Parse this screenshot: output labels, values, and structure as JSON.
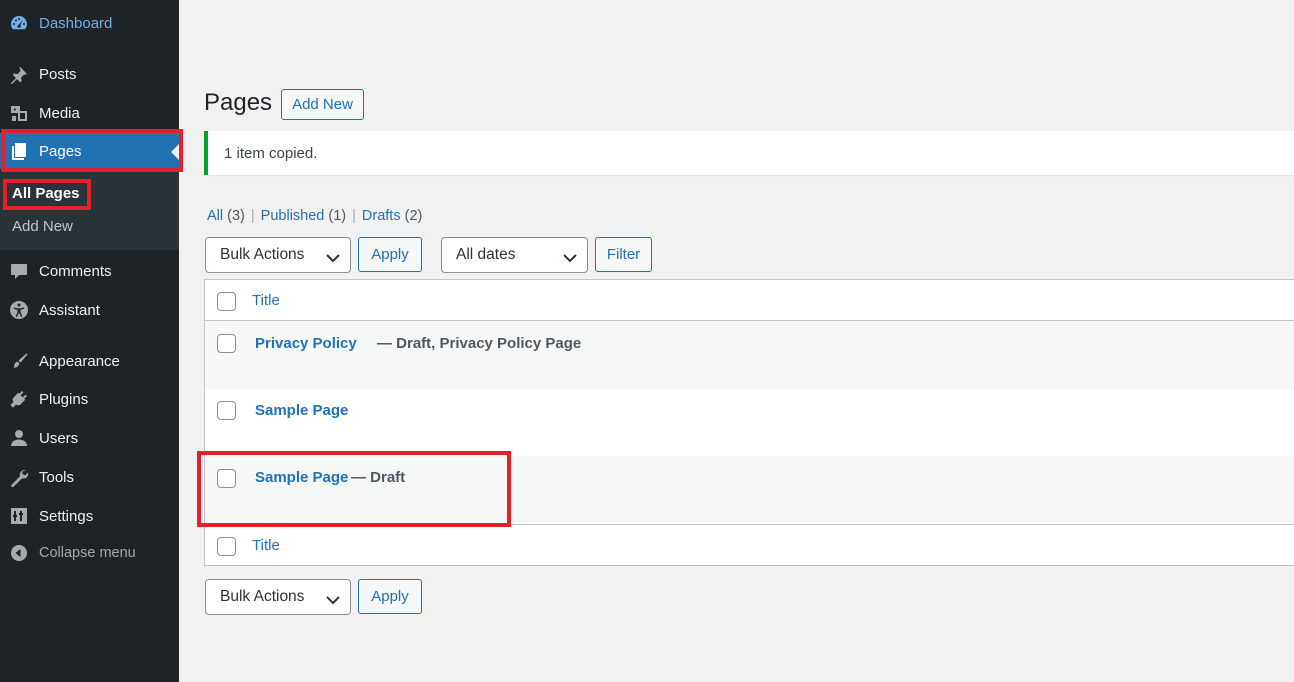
{
  "sidebar": {
    "items": [
      {
        "label": "Dashboard",
        "icon": "dashboard-icon"
      },
      {
        "label": "Posts",
        "icon": "pushpin-icon"
      },
      {
        "label": "Media",
        "icon": "media-icon"
      },
      {
        "label": "Pages",
        "icon": "pages-icon"
      },
      {
        "label": "Comments",
        "icon": "comment-icon"
      },
      {
        "label": "Assistant",
        "icon": "accessibility-icon"
      },
      {
        "label": "Appearance",
        "icon": "paintbrush-icon"
      },
      {
        "label": "Plugins",
        "icon": "plugin-icon"
      },
      {
        "label": "Users",
        "icon": "user-icon"
      },
      {
        "label": "Tools",
        "icon": "wrench-icon"
      },
      {
        "label": "Settings",
        "icon": "settings-icon"
      }
    ],
    "submenu": [
      {
        "label": "All Pages"
      },
      {
        "label": "Add New"
      }
    ],
    "collapse_label": "Collapse menu"
  },
  "colors": {
    "sidebar_bg": "#1d2327",
    "active_bg": "#2271b1",
    "link": "#2271b1",
    "notice_success": "#00a32a",
    "highlight": "#e4202c"
  },
  "header": {
    "title": "Pages",
    "add_new_label": "Add New"
  },
  "notice": {
    "message": "1 item copied."
  },
  "filters": {
    "views": [
      {
        "label": "All",
        "count": "(3)"
      },
      {
        "label": "Published",
        "count": "(1)"
      },
      {
        "label": "Drafts",
        "count": "(2)"
      }
    ],
    "separator": "|",
    "bulk_actions": "Bulk Actions",
    "apply_label": "Apply",
    "dates": "All dates",
    "filter_label": "Filter"
  },
  "table": {
    "column_title": "Title",
    "rows": [
      {
        "title": "Privacy Policy",
        "state": "— Draft, Privacy Policy Page"
      },
      {
        "title": "Sample Page",
        "state": ""
      },
      {
        "title": "Sample Page",
        "state": "— Draft"
      }
    ]
  },
  "bottom": {
    "bulk_actions": "Bulk Actions",
    "apply_label": "Apply"
  }
}
